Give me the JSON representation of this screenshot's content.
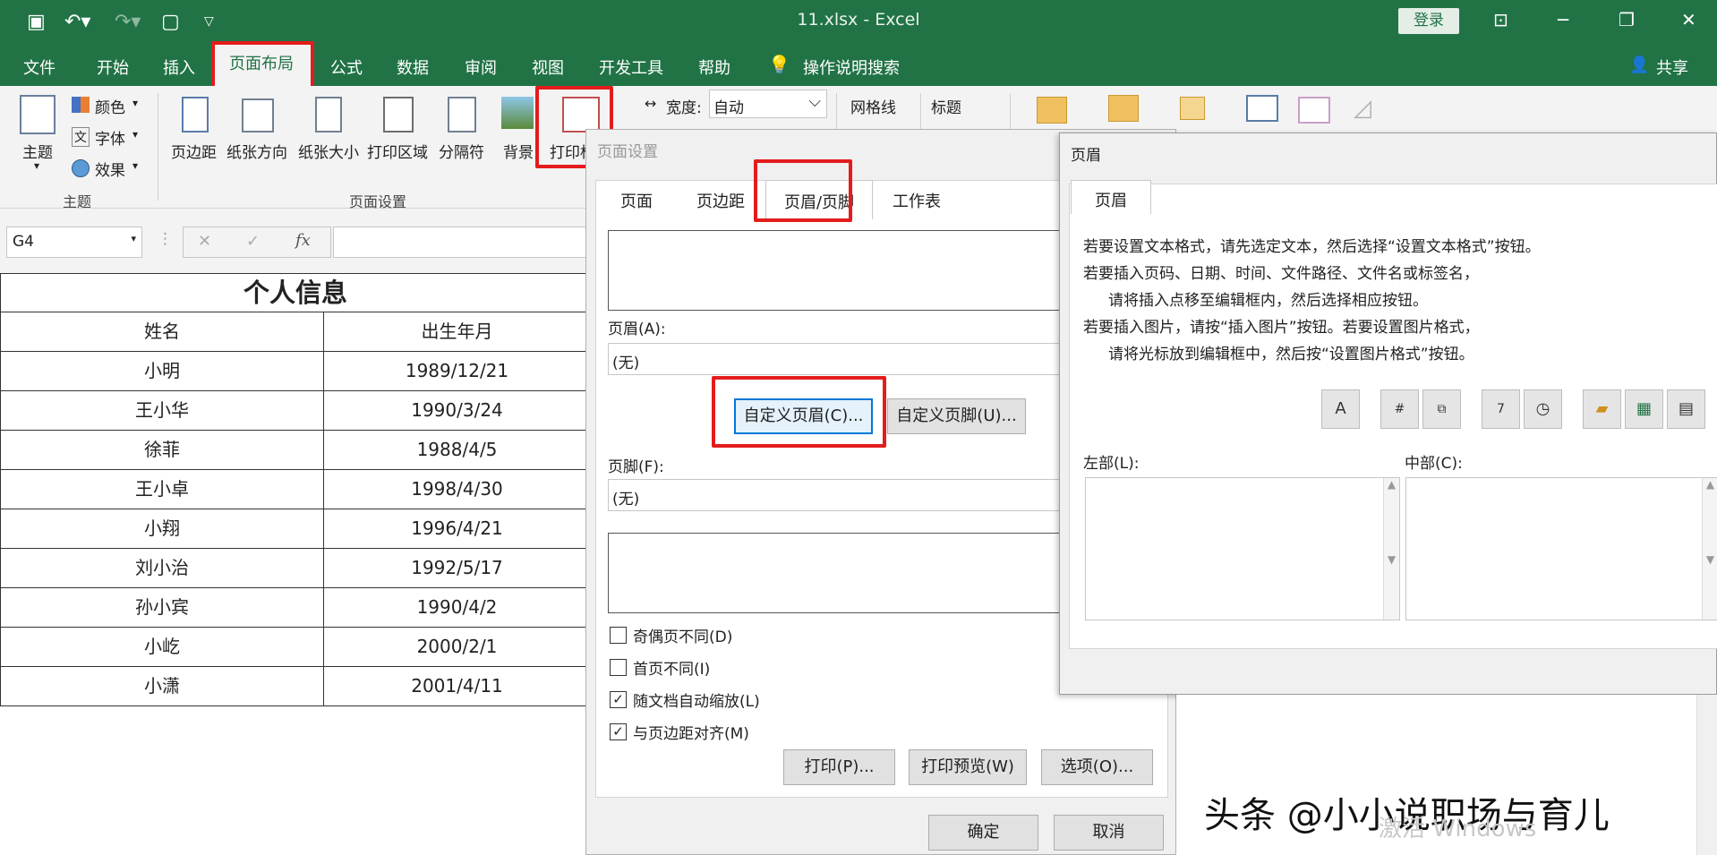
{
  "window": {
    "title": "11.xlsx  -  Excel",
    "login": "登录",
    "share": "共享"
  },
  "menu": [
    "文件",
    "开始",
    "插入",
    "页面布局",
    "公式",
    "数据",
    "审阅",
    "视图",
    "开发工具",
    "帮助"
  ],
  "search": "操作说明搜索",
  "ribbon": {
    "theme": {
      "main": "主题",
      "colors": "颜色",
      "fonts": "字体",
      "effects": "效果",
      "group": "主题"
    },
    "setup": {
      "margins": "页边距",
      "orientation": "纸张方向",
      "size": "纸张大小",
      "print_area": "打印区域",
      "breaks": "分隔符",
      "background": "背景",
      "print_titles": "打印标",
      "group": "页面设置"
    },
    "scale": {
      "width_label": "宽度:",
      "width_value": "自动"
    },
    "sheet_opts": {
      "gridlines": "网格线",
      "headings": "标题"
    }
  },
  "namebox": "G4",
  "fx": "fx",
  "sheet": {
    "title": "个人信息",
    "headers": [
      "姓名",
      "出生年月"
    ],
    "rows": [
      [
        "小明",
        "1989/12/21"
      ],
      [
        "王小华",
        "1990/3/24"
      ],
      [
        "徐菲",
        "1988/4/5"
      ],
      [
        "王小卓",
        "1998/4/30"
      ],
      [
        "小翔",
        "1996/4/21"
      ],
      [
        "刘小治",
        "1992/5/17"
      ],
      [
        "孙小宾",
        "1990/4/2"
      ],
      [
        "小屹",
        "2000/2/1"
      ],
      [
        "小潇",
        "2001/4/11"
      ]
    ]
  },
  "page_setup": {
    "title": "页面设置",
    "tabs": [
      "页面",
      "页边距",
      "页眉/页脚",
      "工作表"
    ],
    "header_label": "页眉(A):",
    "header_value": "(无)",
    "custom_header": "自定义页眉(C)...",
    "custom_footer": "自定义页脚(U)...",
    "footer_label": "页脚(F):",
    "footer_value": "(无)",
    "checks": [
      {
        "label": "奇偶页不同(D)",
        "checked": false
      },
      {
        "label": "首页不同(I)",
        "checked": false
      },
      {
        "label": "随文档自动缩放(L)",
        "checked": true
      },
      {
        "label": "与页边距对齐(M)",
        "checked": true
      }
    ],
    "print": "打印(P)...",
    "preview": "打印预览(W)",
    "options": "选项(O)...",
    "ok": "确定",
    "cancel": "取消"
  },
  "header_dlg": {
    "title": "页眉",
    "tab": "页眉",
    "instructions": [
      "若要设置文本格式，请先选定文本，然后选择“设置文本格式”按钮。",
      "若要插入页码、日期、时间、文件路径、文件名或标签名，",
      "请将插入点移至编辑框内，然后选择相应按钮。",
      "若要插入图片，请按“插入图片”按钮。若要设置图片格式，",
      "请将光标放到编辑框中，然后按“设置图片格式”按钮。"
    ],
    "left_label": "左部(L):",
    "center_label": "中部(C):"
  },
  "watermark": {
    "line1": "头条 @小小说职场与育儿",
    "line2": "激活 Windows"
  }
}
